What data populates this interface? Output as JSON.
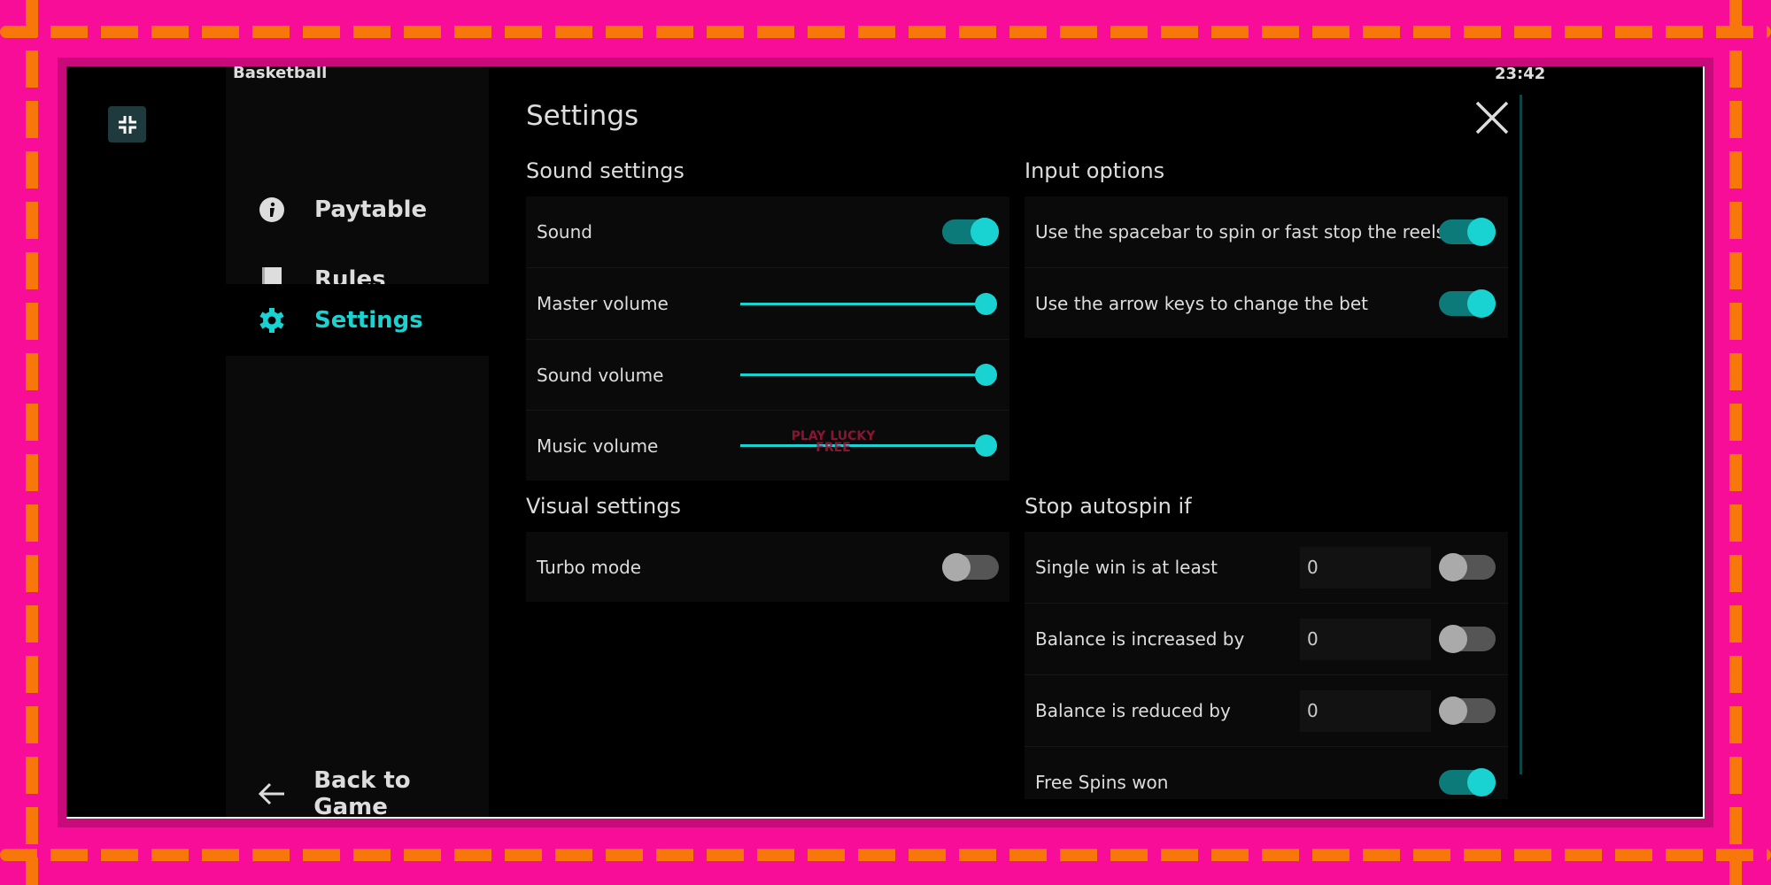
{
  "app": {
    "title": "Basketball",
    "clock": "23:42",
    "watermark": "PLAY LUCKY FREE"
  },
  "sidebar": {
    "items": [
      {
        "label": "Paytable",
        "icon": "info-icon",
        "active": false
      },
      {
        "label": "Rules",
        "icon": "book-icon",
        "active": false
      },
      {
        "label": "Settings",
        "icon": "gear-icon",
        "active": true
      }
    ],
    "back_label": "Back to Game"
  },
  "settings": {
    "title": "Settings",
    "sound": {
      "header": "Sound settings",
      "sound_label": "Sound",
      "sound_on": true,
      "sliders": [
        {
          "label": "Master volume",
          "value": 100
        },
        {
          "label": "Sound volume",
          "value": 100
        },
        {
          "label": "Music volume",
          "value": 100
        }
      ]
    },
    "visual": {
      "header": "Visual settings",
      "turbo_label": "Turbo mode",
      "turbo_on": false
    },
    "input": {
      "header": "Input options",
      "items": [
        {
          "label": "Use the spacebar to spin or fast stop the reels",
          "on": true
        },
        {
          "label": "Use the arrow keys to change the bet",
          "on": true
        }
      ]
    },
    "autospin": {
      "header": "Stop autospin if",
      "items": [
        {
          "label": "Single win is at least",
          "value": "0",
          "on": false
        },
        {
          "label": "Balance is increased by",
          "value": "0",
          "on": false
        },
        {
          "label": "Balance is reduced by",
          "value": "0",
          "on": false
        },
        {
          "label": "Free Spins won",
          "on": true
        }
      ]
    }
  },
  "colors": {
    "accent": "#19d3d3",
    "frame": "#f70d98",
    "dash": "#f7770b"
  }
}
